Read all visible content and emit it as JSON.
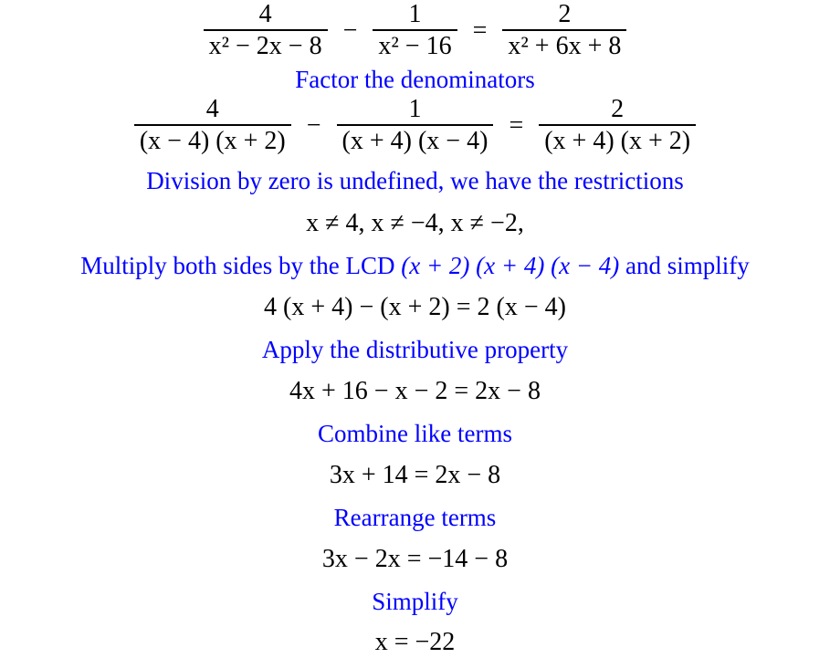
{
  "steps": {
    "eq1": {
      "frac1": {
        "num": "4",
        "den": "x² − 2x − 8"
      },
      "op1": "−",
      "frac2": {
        "num": "1",
        "den": "x² − 16"
      },
      "op2": "=",
      "frac3": {
        "num": "2",
        "den": "x² + 6x + 8"
      }
    },
    "note1": "Factor the denominators",
    "eq2": {
      "frac1": {
        "num": "4",
        "den": "(x − 4) (x + 2)"
      },
      "op1": "−",
      "frac2": {
        "num": "1",
        "den": "(x + 4) (x − 4)"
      },
      "op2": "=",
      "frac3": {
        "num": "2",
        "den": "(x + 4) (x + 2)"
      }
    },
    "note2": "Division by zero is undefined, we have the restrictions",
    "eq3": "x ≠ 4,  x ≠ −4,  x ≠ −2,",
    "note3": {
      "prefix": "Multiply both sides by the LCD",
      "lcd": "(x + 2) (x + 4) (x − 4)",
      "suffix": "and simplify"
    },
    "eq4": "4 (x + 4) − (x + 2) = 2 (x − 4)",
    "note4": "Apply the distributive property",
    "eq5": "4x + 16 − x − 2 = 2x − 8",
    "note5": "Combine like terms",
    "eq6": "3x + 14 = 2x − 8",
    "note6": "Rearrange terms",
    "eq7": "3x − 2x = −14 − 8",
    "note7": "Simplify",
    "eq8": "x = −22"
  },
  "colors": {
    "note": "#0000ff",
    "equation": "#000000"
  }
}
